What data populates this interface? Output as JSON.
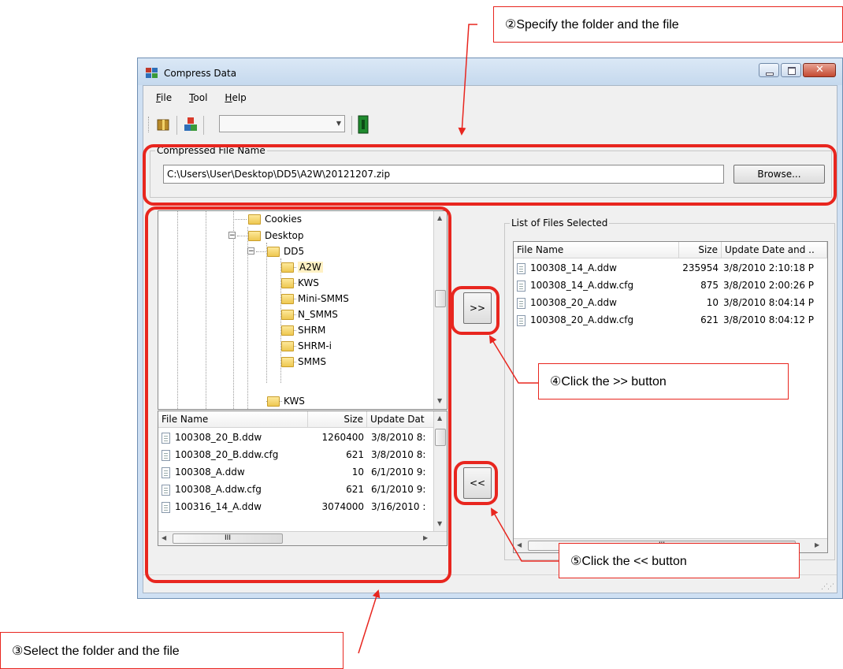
{
  "window": {
    "title": "Compress Data",
    "menu": [
      {
        "label": "File",
        "mnemonic": "F",
        "rest": "ile"
      },
      {
        "label": "Tool",
        "mnemonic": "T",
        "rest": "ool"
      },
      {
        "label": "Help",
        "mnemonic": "H",
        "rest": "elp"
      }
    ]
  },
  "compressed_file": {
    "group_label": "Compressed File Name",
    "path": "C:\\Users\\User\\Desktop\\DD5\\A2W\\20121207.zip",
    "browse_label": "Browse..."
  },
  "tree": {
    "items": [
      {
        "label": "Cookies"
      },
      {
        "label": "Desktop"
      },
      {
        "label": "DD5"
      },
      {
        "label": "A2W",
        "selected": true
      },
      {
        "label": "KWS"
      },
      {
        "label": "Mini-SMMS"
      },
      {
        "label": "N_SMMS"
      },
      {
        "label": "SHRM"
      },
      {
        "label": "SHRM-i"
      },
      {
        "label": "SMMS"
      },
      {
        "label": "KWS"
      }
    ]
  },
  "source_list": {
    "columns": [
      "File Name",
      "Size",
      "Update Dat"
    ],
    "rows": [
      {
        "name": "100308_20_B.ddw",
        "size": "1260400",
        "date": "3/8/2010 8:"
      },
      {
        "name": "100308_20_B.ddw.cfg",
        "size": "621",
        "date": "3/8/2010 8:"
      },
      {
        "name": "100308_A.ddw",
        "size": "10",
        "date": "6/1/2010 9:"
      },
      {
        "name": "100308_A.ddw.cfg",
        "size": "621",
        "date": "6/1/2010 9:"
      },
      {
        "name": "100316_14_A.ddw",
        "size": "3074000",
        "date": "3/16/2010 :"
      }
    ],
    "scroll_marker": "III"
  },
  "buttons": {
    "add": ">>",
    "remove": "<<"
  },
  "selected_list": {
    "group_label": "List of Files Selected",
    "columns": [
      "File Name",
      "Size",
      "Update Date and .."
    ],
    "rows": [
      {
        "name": "100308_14_A.ddw",
        "size": "235954",
        "date": "3/8/2010 2:10:18 P"
      },
      {
        "name": "100308_14_A.ddw.cfg",
        "size": "875",
        "date": "3/8/2010 2:00:26 P"
      },
      {
        "name": "100308_20_A.ddw",
        "size": "10",
        "date": "3/8/2010 8:04:14 P"
      },
      {
        "name": "100308_20_A.ddw.cfg",
        "size": "621",
        "date": "3/8/2010 8:04:12 P"
      }
    ],
    "scroll_marker": "III"
  },
  "annotations": {
    "specify": "②Specify the folder and the file",
    "select": "③Select the folder and the file",
    "click_add": "④Click the >> button",
    "click_remove": "⑤Click the << button"
  },
  "colors": {
    "annotation": "#e8261f",
    "window_frame": "#cfe0f3",
    "close_button": "#c44a32"
  }
}
